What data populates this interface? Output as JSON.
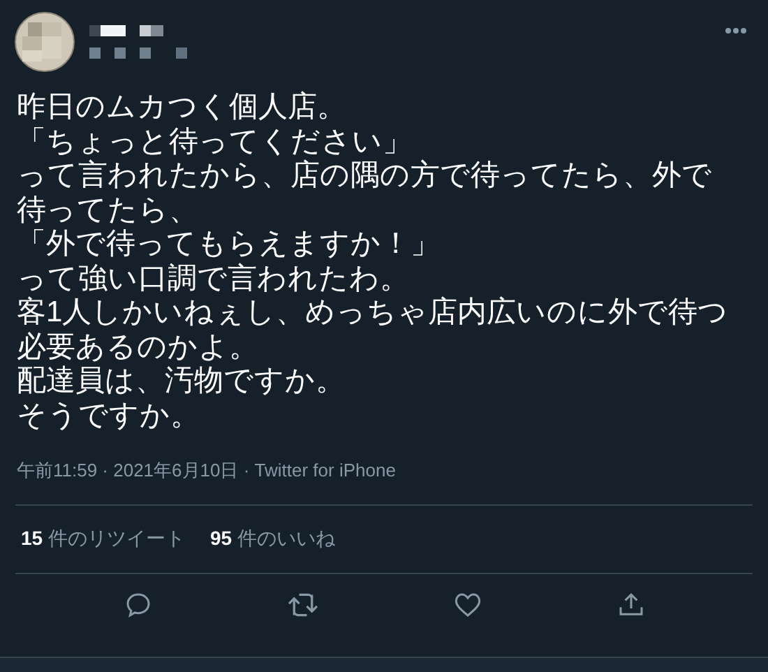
{
  "tweet": {
    "paragraphs": [
      "昨日のムカつく個人店。",
      "「ちょっと待ってください」",
      "って言われたから、店の隅の方で待ってたら、外で待ってたら、",
      "「外で待ってもらえますか！」",
      "って強い口調で言われたわ。",
      "客1人しかいねぇし、めっちゃ店内広いのに外で待つ必要あるのかよ。",
      "配達員は、汚物ですか。",
      "そうですか。"
    ],
    "meta": "午前11:59 · 2021年6月10日 · Twitter for iPhone",
    "stats": [
      {
        "count": "15",
        "label": "件のリツイート"
      },
      {
        "count": "95",
        "label": "件のいいね"
      }
    ]
  }
}
